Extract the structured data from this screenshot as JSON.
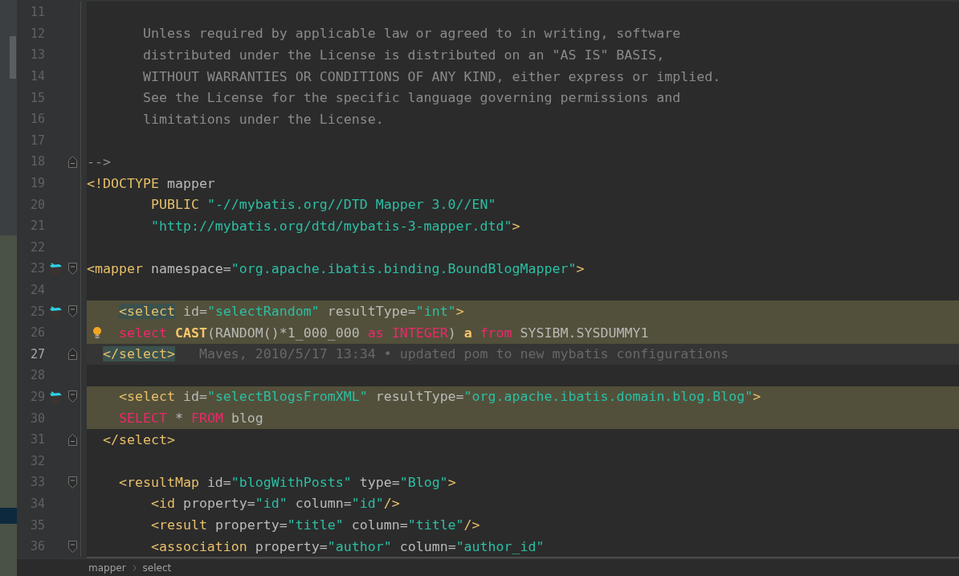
{
  "editor": {
    "lines": [
      {
        "number": "11",
        "changed": false,
        "current": false
      },
      {
        "number": "12",
        "tokens": [
          {
            "text": "       Unless required by applicable law or agreed to in writing, software",
            "kind": "comment"
          }
        ],
        "changed": false,
        "current": false
      },
      {
        "number": "13",
        "tokens": [
          {
            "text": "       distributed under the License is distributed on an \"AS IS\" BASIS,",
            "kind": "comment"
          }
        ],
        "changed": false,
        "current": false
      },
      {
        "number": "14",
        "tokens": [
          {
            "text": "       WITHOUT WARRANTIES OR CONDITIONS OF ANY KIND, either express or implied.",
            "kind": "comment"
          }
        ],
        "changed": false,
        "current": false
      },
      {
        "number": "15",
        "tokens": [
          {
            "text": "       See the License for the specific language governing permissions and",
            "kind": "comment"
          }
        ],
        "changed": false,
        "current": false
      },
      {
        "number": "16",
        "tokens": [
          {
            "text": "       limitations under the License.",
            "kind": "comment"
          }
        ],
        "changed": false,
        "current": false
      },
      {
        "number": "17",
        "changed": false,
        "current": false
      },
      {
        "number": "18",
        "fold_marker": {
          "kind": "end"
        },
        "tokens": [
          {
            "text": "-->",
            "kind": "comment"
          }
        ],
        "changed": false,
        "current": false
      },
      {
        "number": "19",
        "tokens": [
          {
            "text": "<!DOCTYPE",
            "kind": "tag"
          },
          {
            "text": " mapper",
            "kind": "plain"
          }
        ],
        "changed": false,
        "current": false
      },
      {
        "number": "20",
        "tokens": [
          {
            "text": "        PUBLIC",
            "kind": "tag"
          },
          {
            "text": " \"-//mybatis.org//DTD Mapper 3.0//EN\"",
            "kind": "string"
          }
        ],
        "changed": false,
        "current": false
      },
      {
        "number": "21",
        "tokens": [
          {
            "text": "        \"http://mybatis.org/dtd/mybatis-3-mapper.dtd\"",
            "kind": "string"
          },
          {
            "text": ">",
            "kind": "tag"
          }
        ],
        "changed": false,
        "current": false
      },
      {
        "number": "22",
        "changed": false,
        "current": false
      },
      {
        "number": "23",
        "gutter": {
          "kind": "bird"
        },
        "fold_marker": {
          "kind": "start"
        },
        "tokens": [
          {
            "text": "<mapper",
            "kind": "tag"
          },
          {
            "text": " namespace=",
            "kind": "attr"
          },
          {
            "text": "\"org.apache.ibatis.binding.BoundBlogMapper\"",
            "kind": "string"
          },
          {
            "text": ">",
            "kind": "tag"
          }
        ],
        "changed": false,
        "current": false
      },
      {
        "number": "24",
        "changed": false,
        "current": false
      },
      {
        "number": "25",
        "gutter": {
          "kind": "bird"
        },
        "fold_marker": {
          "kind": "start"
        },
        "tokens": [
          {
            "text": "    <select",
            "kind": "match"
          },
          {
            "text": " id=",
            "kind": "attr"
          },
          {
            "text": "\"selectRandom\"",
            "kind": "string"
          },
          {
            "text": " resultType=",
            "kind": "attr"
          },
          {
            "text": "\"int\"",
            "kind": "string"
          },
          {
            "text": ">",
            "kind": "tag"
          }
        ],
        "changed": true,
        "current": false
      },
      {
        "number": "26",
        "gutter": {
          "kind": "bulb"
        },
        "tokens": [
          {
            "text": "    select",
            "kind": "sql"
          },
          {
            "text": " CAST",
            "kind": "func"
          },
          {
            "text": "(RANDOM()*1_000_000",
            "kind": "plain"
          },
          {
            "text": " as INTEGER",
            "kind": "sql"
          },
          {
            "text": ")",
            "kind": "plain"
          },
          {
            "text": " a",
            "kind": "func"
          },
          {
            "text": " from",
            "kind": "sql"
          },
          {
            "text": " SYSIBM.SYSDUMMY1",
            "kind": "plain"
          }
        ],
        "changed": true,
        "current": false
      },
      {
        "number": "27",
        "fold_marker": {
          "kind": "end"
        },
        "tokens": [
          {
            "text": "  </select>",
            "kind": "match"
          }
        ],
        "annotation": "Maves, 2010/5/17 13:34 • updated pom to new mybatis configurations",
        "changed": false,
        "current": true
      },
      {
        "number": "28",
        "changed": false,
        "current": false
      },
      {
        "number": "29",
        "gutter": {
          "kind": "bird"
        },
        "fold_marker": {
          "kind": "start"
        },
        "tokens": [
          {
            "text": "    <select",
            "kind": "tag"
          },
          {
            "text": " id=",
            "kind": "attr"
          },
          {
            "text": "\"selectBlogsFromXML\"",
            "kind": "string"
          },
          {
            "text": " resultType=",
            "kind": "attr"
          },
          {
            "text": "\"org.apache.ibatis.domain.blog.Blog\"",
            "kind": "string"
          },
          {
            "text": ">",
            "kind": "tag"
          }
        ],
        "changed": true,
        "current": false
      },
      {
        "number": "30",
        "tokens": [
          {
            "text": "    SELECT",
            "kind": "sql"
          },
          {
            "text": " *",
            "kind": "plain"
          },
          {
            "text": " FROM",
            "kind": "sql"
          },
          {
            "text": " blog",
            "kind": "plain"
          }
        ],
        "changed": true,
        "current": false
      },
      {
        "number": "31",
        "fold_marker": {
          "kind": "end"
        },
        "tokens": [
          {
            "text": "  </select>",
            "kind": "tag"
          }
        ],
        "changed": false,
        "current": false
      },
      {
        "number": "32",
        "changed": false,
        "current": false
      },
      {
        "number": "33",
        "fold_marker": {
          "kind": "start"
        },
        "tokens": [
          {
            "text": "    <resultMap",
            "kind": "tag"
          },
          {
            "text": " id=",
            "kind": "attr"
          },
          {
            "text": "\"blogWithPosts\"",
            "kind": "string"
          },
          {
            "text": " type=",
            "kind": "attr"
          },
          {
            "text": "\"Blog\"",
            "kind": "string"
          },
          {
            "text": ">",
            "kind": "tag"
          }
        ],
        "changed": false,
        "current": false
      },
      {
        "number": "34",
        "tokens": [
          {
            "text": "        <id",
            "kind": "tag"
          },
          {
            "text": " property=",
            "kind": "attr"
          },
          {
            "text": "\"id\"",
            "kind": "string"
          },
          {
            "text": " column=",
            "kind": "attr"
          },
          {
            "text": "\"id\"",
            "kind": "string"
          },
          {
            "text": "/>",
            "kind": "tag"
          }
        ],
        "changed": false,
        "current": false
      },
      {
        "number": "35",
        "tokens": [
          {
            "text": "        <result",
            "kind": "tag"
          },
          {
            "text": " property=",
            "kind": "attr"
          },
          {
            "text": "\"title\"",
            "kind": "string"
          },
          {
            "text": " column=",
            "kind": "attr"
          },
          {
            "text": "\"title\"",
            "kind": "string"
          },
          {
            "text": "/>",
            "kind": "tag"
          }
        ],
        "changed": false,
        "current": false
      },
      {
        "number": "36",
        "fold_marker": {
          "kind": "start"
        },
        "tokens": [
          {
            "text": "        <association",
            "kind": "tag"
          },
          {
            "text": " property=",
            "kind": "attr"
          },
          {
            "text": "\"author\"",
            "kind": "string"
          },
          {
            "text": " column=",
            "kind": "attr"
          },
          {
            "text": "\"author_id\"",
            "kind": "string"
          }
        ],
        "changed": false,
        "current": false
      }
    ]
  },
  "breadcrumbs": [
    {
      "label": "mapper"
    },
    {
      "label": "select"
    }
  ]
}
